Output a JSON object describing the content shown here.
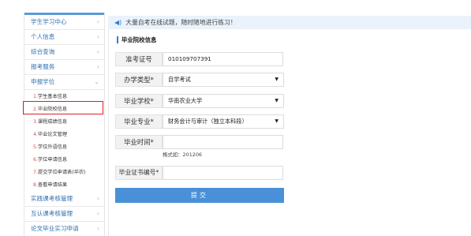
{
  "sidebar": {
    "items": [
      {
        "label": "学生学习中心",
        "arrow": "›"
      },
      {
        "label": "个人信息",
        "arrow": "›"
      },
      {
        "label": "综合查询",
        "arrow": "›"
      },
      {
        "label": "报考服务",
        "arrow": "›"
      },
      {
        "label": "申报学位",
        "arrow": "⌄"
      }
    ],
    "sub_items": [
      {
        "num": "1.",
        "label": "学生基本信息"
      },
      {
        "num": "2.",
        "label": "毕业院校信息"
      },
      {
        "num": "3.",
        "label": "课程成绩信息"
      },
      {
        "num": "4.",
        "label": "毕业论文管理"
      },
      {
        "num": "5.",
        "label": "学位外语信息"
      },
      {
        "num": "6.",
        "label": "学位申请信息"
      },
      {
        "num": "7.",
        "label": "提交学位申请表(华农)"
      },
      {
        "num": "8.",
        "label": "查看申请结果"
      }
    ],
    "bottom_items": [
      {
        "label": "实践课考核管理",
        "arrow": "›"
      },
      {
        "label": "互认课考核管理",
        "arrow": "›"
      },
      {
        "label": "论文毕业实习申请",
        "arrow": "›"
      }
    ]
  },
  "notice": {
    "icon": "speaker-icon",
    "text": "大量自考在线试题，随时随地进行练习！"
  },
  "form": {
    "section_title": "毕业院校信息",
    "exam_no_label": "准考证号",
    "exam_no_value": "010109707391",
    "school_type_label": "办学类型*",
    "school_type_value": "自学考试",
    "school_label": "毕业学校*",
    "school_value": "华南农业大学",
    "major_label": "毕业专业*",
    "major_value": "财务会计与审计（独立本科段）",
    "grad_time_label": "毕业时间*",
    "grad_time_value": "",
    "grad_time_hint": "格式如：201206",
    "cert_no_label": "毕业证书编号*",
    "cert_no_value": "",
    "submit_label": "提交"
  },
  "colors": {
    "accent": "#4a90d9",
    "link": "#2f6fb0",
    "highlight": "#e02020"
  }
}
